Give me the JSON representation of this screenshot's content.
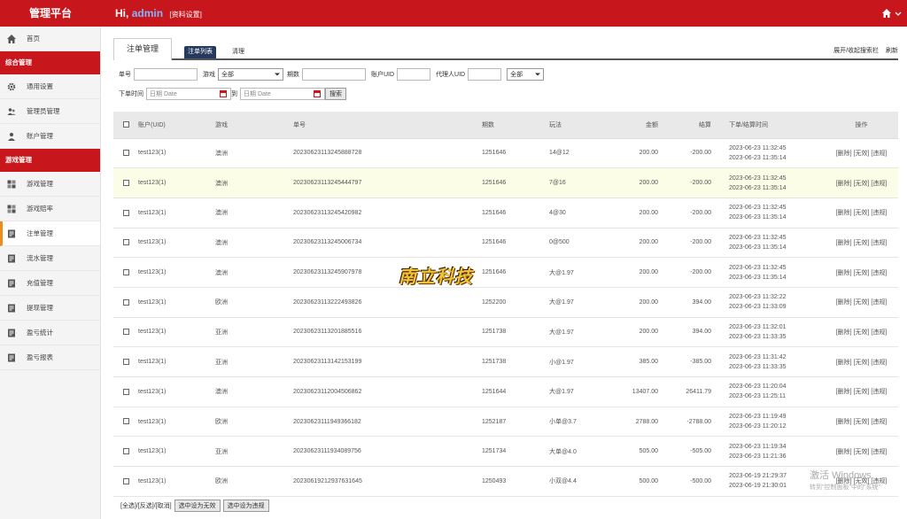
{
  "topbar": {
    "brand": "管理平台",
    "greeting": "Hi,",
    "username": "admin",
    "profile_link": "[资料设置]"
  },
  "sidebar": [
    {
      "type": "item",
      "label": "首页",
      "icon": "home-icon"
    },
    {
      "type": "group",
      "label": "综合管理"
    },
    {
      "type": "item",
      "label": "通用设置",
      "icon": "gear-icon"
    },
    {
      "type": "item",
      "label": "管理员管理",
      "icon": "users-icon"
    },
    {
      "type": "item",
      "label": "账户管理",
      "icon": "user-icon"
    },
    {
      "type": "group",
      "label": "游戏管理"
    },
    {
      "type": "item",
      "label": "游戏管理",
      "icon": "grid-icon"
    },
    {
      "type": "item",
      "label": "游戏赔率",
      "icon": "grid-icon"
    },
    {
      "type": "item",
      "label": "注单管理",
      "icon": "doc-icon",
      "active": true
    },
    {
      "type": "item",
      "label": "流水管理",
      "icon": "doc-icon"
    },
    {
      "type": "item",
      "label": "充值管理",
      "icon": "doc-icon"
    },
    {
      "type": "item",
      "label": "提现管理",
      "icon": "doc-icon"
    },
    {
      "type": "item",
      "label": "盈亏统计",
      "icon": "doc-icon"
    },
    {
      "type": "item",
      "label": "盈亏报表",
      "icon": "doc-icon"
    }
  ],
  "main": {
    "page_tab": "注单管理",
    "subtab_active": "注单列表",
    "subtab_other": "清理",
    "right_links": [
      "展开/收起搜索栏",
      "刷新"
    ]
  },
  "filters": {
    "order_no": "单号",
    "game": "游戏",
    "game_selected": "全部",
    "period": "期数",
    "account_uid": "账户UID",
    "agent_uid": "代理人UID",
    "agent_selected": "全部",
    "order_time": "下单时间",
    "date_placeholder": "日期 Date",
    "to": "到",
    "search_btn": "搜索"
  },
  "table": {
    "headers": [
      "账户(UID)",
      "游戏",
      "单号",
      "期数",
      "玩法",
      "金额",
      "结算",
      "下单/结算时间",
      "操作"
    ],
    "ops": "[删除] [无效] [违规]",
    "rows": [
      {
        "account": "test123(1)",
        "game": "澳洲",
        "order": "20230623113245888728",
        "period": "1251646",
        "play": "14@12",
        "amount": "200.00",
        "settle": "-200.00",
        "t1": "2023-06-23 11:32:45",
        "t2": "2023-06-23 11:35:14"
      },
      {
        "account": "test123(1)",
        "game": "澳洲",
        "order": "20230623113245444797",
        "period": "1251646",
        "play": "7@16",
        "amount": "200.00",
        "settle": "-200.00",
        "t1": "2023-06-23 11:32:45",
        "t2": "2023-06-23 11:35:14"
      },
      {
        "account": "test123(1)",
        "game": "澳洲",
        "order": "20230623113245420982",
        "period": "1251646",
        "play": "4@30",
        "amount": "200.00",
        "settle": "-200.00",
        "t1": "2023-06-23 11:32:45",
        "t2": "2023-06-23 11:35:14"
      },
      {
        "account": "test123(1)",
        "game": "澳洲",
        "order": "20230623113245006734",
        "period": "1251646",
        "play": "0@500",
        "amount": "200.00",
        "settle": "-200.00",
        "t1": "2023-06-23 11:32:45",
        "t2": "2023-06-23 11:35:14"
      },
      {
        "account": "test123(1)",
        "game": "澳洲",
        "order": "20230623113245907978",
        "period": "1251646",
        "play": "大@1.97",
        "amount": "200.00",
        "settle": "-200.00",
        "t1": "2023-06-23 11:32:45",
        "t2": "2023-06-23 11:35:14"
      },
      {
        "account": "test123(1)",
        "game": "欧洲",
        "order": "20230623113222493826",
        "period": "1252200",
        "play": "大@1.97",
        "amount": "200.00",
        "settle": "394.00",
        "t1": "2023-06-23 11:32:22",
        "t2": "2023-06-23 11:33:09"
      },
      {
        "account": "test123(1)",
        "game": "亚洲",
        "order": "20230623113201885516",
        "period": "1251738",
        "play": "大@1.97",
        "amount": "200.00",
        "settle": "394.00",
        "t1": "2023-06-23 11:32:01",
        "t2": "2023-06-23 11:33:35"
      },
      {
        "account": "test123(1)",
        "game": "亚洲",
        "order": "20230623113142153199",
        "period": "1251738",
        "play": "小@1.97",
        "amount": "385.00",
        "settle": "-385.00",
        "t1": "2023-06-23 11:31:42",
        "t2": "2023-06-23 11:33:35"
      },
      {
        "account": "test123(1)",
        "game": "澳洲",
        "order": "20230623112004506862",
        "period": "1251644",
        "play": "大@1.97",
        "amount": "13407.00",
        "settle": "26411.79",
        "t1": "2023-06-23 11:20:04",
        "t2": "2023-06-23 11:25:11"
      },
      {
        "account": "test123(1)",
        "game": "欧洲",
        "order": "20230623111949366182",
        "period": "1252187",
        "play": "小单@3.7",
        "amount": "2788.00",
        "settle": "-2788.00",
        "t1": "2023-06-23 11:19:49",
        "t2": "2023-06-23 11:20:12"
      },
      {
        "account": "test123(1)",
        "game": "亚洲",
        "order": "20230623111934089756",
        "period": "1251734",
        "play": "大单@4.0",
        "amount": "505.00",
        "settle": "-505.00",
        "t1": "2023-06-23 11:19:34",
        "t2": "2023-06-23 11:21:36"
      },
      {
        "account": "test123(1)",
        "game": "欧洲",
        "order": "20230619212937631645",
        "period": "1250493",
        "play": "小双@4.4",
        "amount": "500.00",
        "settle": "-500.00",
        "t1": "2023-06-19 21:29:37",
        "t2": "2023-06-19 21:30:01"
      }
    ]
  },
  "footer": {
    "select_links": "[全选]/[反选]/[取消]",
    "btn_invalid": "选中设为无效",
    "btn_violation": "选中设为违规"
  },
  "overlay": {
    "watermark": "南立科技",
    "win_line1": "激活 Windows",
    "win_line2": "转到\"控制面板\"中的\"系统\""
  },
  "colors": {
    "brand_red": "#c8161d",
    "accent_orange": "#ec8c1a",
    "tab_navy": "#263a5e",
    "highlight_row": "#fbfde6"
  }
}
